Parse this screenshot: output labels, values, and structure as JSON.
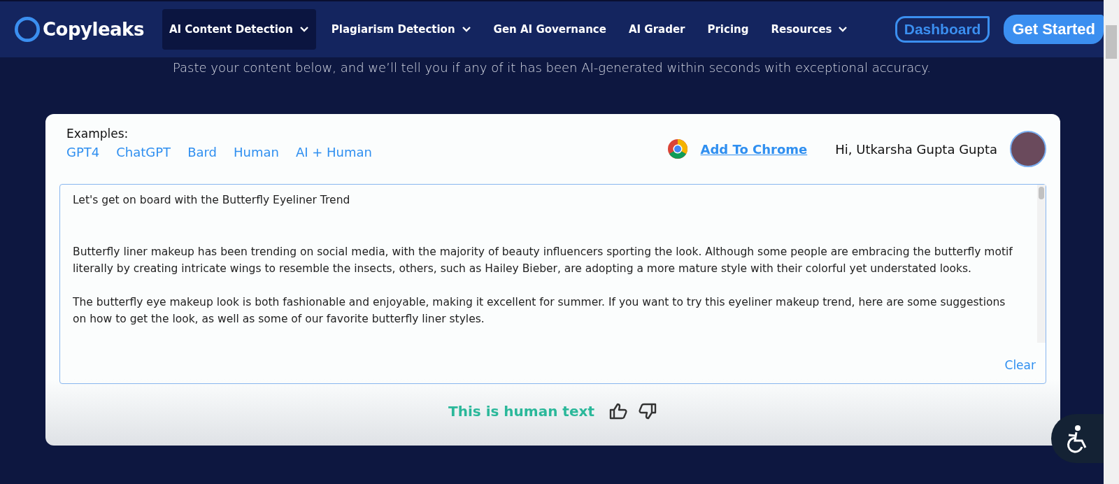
{
  "nav": {
    "logo": "Copyleaks",
    "items": [
      {
        "label": "AI Content Detection",
        "dropdown": true,
        "selected": true
      },
      {
        "label": "Plagiarism Detection",
        "dropdown": true,
        "selected": false
      },
      {
        "label": "Gen AI Governance",
        "dropdown": false,
        "selected": false
      },
      {
        "label": "AI Grader",
        "dropdown": false,
        "selected": false
      },
      {
        "label": "Pricing",
        "dropdown": false,
        "selected": false
      },
      {
        "label": "Resources",
        "dropdown": true,
        "selected": false
      }
    ],
    "dashboard_button": "Dashboard",
    "get_started_button": "Get Started"
  },
  "subtitle": "Paste your content below, and we’ll tell you if any of it has been AI-generated within seconds with exceptional accuracy.",
  "card": {
    "examples_label": "Examples:",
    "examples": [
      "GPT4",
      "ChatGPT",
      "Bard",
      "Human",
      "AI + Human"
    ],
    "add_to_chrome": "Add To Chrome",
    "greeting": "Hi, Utkarsha Gupta Gupta",
    "text_title": "Let's get on board with the Butterfly Eyeliner Trend",
    "paragraphs": [
      "Butterfly liner makeup has been trending on social media, with the majority of beauty influencers sporting the look. Although some people are embracing the butterfly motif literally by creating intricate wings to resemble the insects, others, such as Hailey Bieber, are adopting a more mature style with their colorful yet understated looks.",
      "The butterfly eye makeup look is both fashionable and enjoyable, making it excellent for summer. If you want to try this eyeliner makeup trend, here are some suggestions on how to get the look, as well as some of our favorite butterfly liner styles."
    ],
    "clear": "Clear",
    "result": "This is human text"
  }
}
